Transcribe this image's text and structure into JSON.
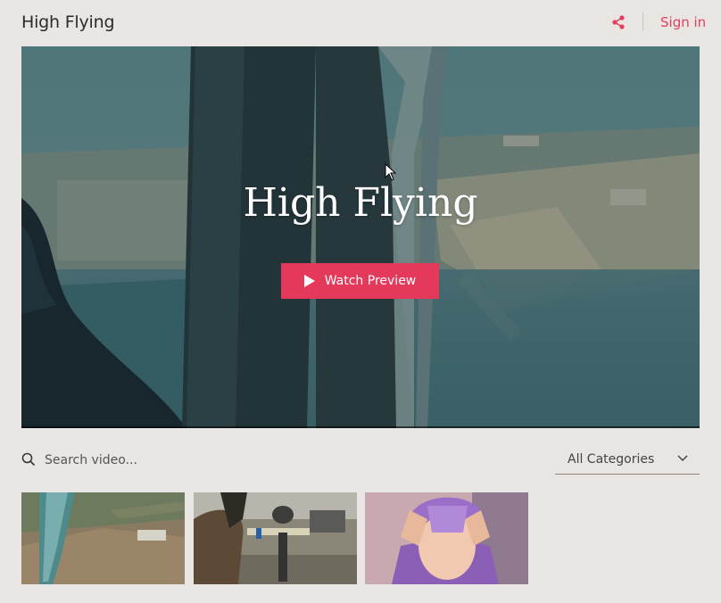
{
  "header": {
    "title": "High Flying",
    "signin_label": "Sign in",
    "share_icon": "share-icon"
  },
  "hero": {
    "title": "High Flying",
    "watch_label": "Watch Preview"
  },
  "search": {
    "placeholder": "Search video..."
  },
  "categories": {
    "selected": "All Categories"
  },
  "videos": [
    {
      "name": "aerial-view-thumbnail"
    },
    {
      "name": "office-dog-thumbnail"
    },
    {
      "name": "purple-hoodie-thumbnail"
    }
  ],
  "colors": {
    "accent": "#e5395b",
    "background": "#e8e5e2"
  }
}
